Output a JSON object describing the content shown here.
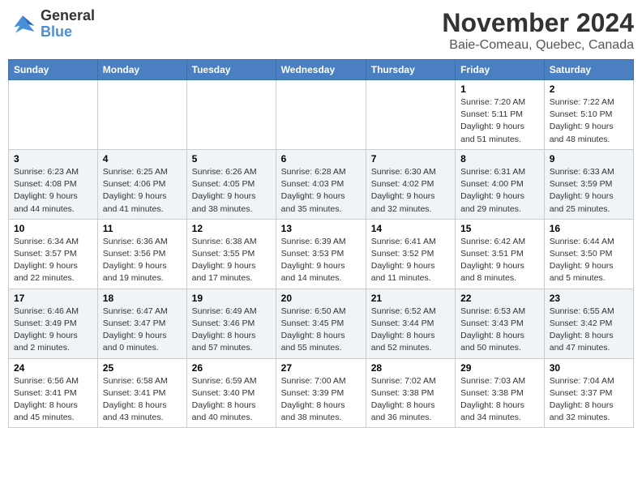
{
  "logo": {
    "line1": "General",
    "line2": "Blue"
  },
  "title": "November 2024",
  "location": "Baie-Comeau, Quebec, Canada",
  "weekdays": [
    "Sunday",
    "Monday",
    "Tuesday",
    "Wednesday",
    "Thursday",
    "Friday",
    "Saturday"
  ],
  "weeks": [
    [
      {
        "day": "",
        "info": ""
      },
      {
        "day": "",
        "info": ""
      },
      {
        "day": "",
        "info": ""
      },
      {
        "day": "",
        "info": ""
      },
      {
        "day": "",
        "info": ""
      },
      {
        "day": "1",
        "info": "Sunrise: 7:20 AM\nSunset: 5:11 PM\nDaylight: 9 hours and 51 minutes."
      },
      {
        "day": "2",
        "info": "Sunrise: 7:22 AM\nSunset: 5:10 PM\nDaylight: 9 hours and 48 minutes."
      }
    ],
    [
      {
        "day": "3",
        "info": "Sunrise: 6:23 AM\nSunset: 4:08 PM\nDaylight: 9 hours and 44 minutes."
      },
      {
        "day": "4",
        "info": "Sunrise: 6:25 AM\nSunset: 4:06 PM\nDaylight: 9 hours and 41 minutes."
      },
      {
        "day": "5",
        "info": "Sunrise: 6:26 AM\nSunset: 4:05 PM\nDaylight: 9 hours and 38 minutes."
      },
      {
        "day": "6",
        "info": "Sunrise: 6:28 AM\nSunset: 4:03 PM\nDaylight: 9 hours and 35 minutes."
      },
      {
        "day": "7",
        "info": "Sunrise: 6:30 AM\nSunset: 4:02 PM\nDaylight: 9 hours and 32 minutes."
      },
      {
        "day": "8",
        "info": "Sunrise: 6:31 AM\nSunset: 4:00 PM\nDaylight: 9 hours and 29 minutes."
      },
      {
        "day": "9",
        "info": "Sunrise: 6:33 AM\nSunset: 3:59 PM\nDaylight: 9 hours and 25 minutes."
      }
    ],
    [
      {
        "day": "10",
        "info": "Sunrise: 6:34 AM\nSunset: 3:57 PM\nDaylight: 9 hours and 22 minutes."
      },
      {
        "day": "11",
        "info": "Sunrise: 6:36 AM\nSunset: 3:56 PM\nDaylight: 9 hours and 19 minutes."
      },
      {
        "day": "12",
        "info": "Sunrise: 6:38 AM\nSunset: 3:55 PM\nDaylight: 9 hours and 17 minutes."
      },
      {
        "day": "13",
        "info": "Sunrise: 6:39 AM\nSunset: 3:53 PM\nDaylight: 9 hours and 14 minutes."
      },
      {
        "day": "14",
        "info": "Sunrise: 6:41 AM\nSunset: 3:52 PM\nDaylight: 9 hours and 11 minutes."
      },
      {
        "day": "15",
        "info": "Sunrise: 6:42 AM\nSunset: 3:51 PM\nDaylight: 9 hours and 8 minutes."
      },
      {
        "day": "16",
        "info": "Sunrise: 6:44 AM\nSunset: 3:50 PM\nDaylight: 9 hours and 5 minutes."
      }
    ],
    [
      {
        "day": "17",
        "info": "Sunrise: 6:46 AM\nSunset: 3:49 PM\nDaylight: 9 hours and 2 minutes."
      },
      {
        "day": "18",
        "info": "Sunrise: 6:47 AM\nSunset: 3:47 PM\nDaylight: 9 hours and 0 minutes."
      },
      {
        "day": "19",
        "info": "Sunrise: 6:49 AM\nSunset: 3:46 PM\nDaylight: 8 hours and 57 minutes."
      },
      {
        "day": "20",
        "info": "Sunrise: 6:50 AM\nSunset: 3:45 PM\nDaylight: 8 hours and 55 minutes."
      },
      {
        "day": "21",
        "info": "Sunrise: 6:52 AM\nSunset: 3:44 PM\nDaylight: 8 hours and 52 minutes."
      },
      {
        "day": "22",
        "info": "Sunrise: 6:53 AM\nSunset: 3:43 PM\nDaylight: 8 hours and 50 minutes."
      },
      {
        "day": "23",
        "info": "Sunrise: 6:55 AM\nSunset: 3:42 PM\nDaylight: 8 hours and 47 minutes."
      }
    ],
    [
      {
        "day": "24",
        "info": "Sunrise: 6:56 AM\nSunset: 3:41 PM\nDaylight: 8 hours and 45 minutes."
      },
      {
        "day": "25",
        "info": "Sunrise: 6:58 AM\nSunset: 3:41 PM\nDaylight: 8 hours and 43 minutes."
      },
      {
        "day": "26",
        "info": "Sunrise: 6:59 AM\nSunset: 3:40 PM\nDaylight: 8 hours and 40 minutes."
      },
      {
        "day": "27",
        "info": "Sunrise: 7:00 AM\nSunset: 3:39 PM\nDaylight: 8 hours and 38 minutes."
      },
      {
        "day": "28",
        "info": "Sunrise: 7:02 AM\nSunset: 3:38 PM\nDaylight: 8 hours and 36 minutes."
      },
      {
        "day": "29",
        "info": "Sunrise: 7:03 AM\nSunset: 3:38 PM\nDaylight: 8 hours and 34 minutes."
      },
      {
        "day": "30",
        "info": "Sunrise: 7:04 AM\nSunset: 3:37 PM\nDaylight: 8 hours and 32 minutes."
      }
    ]
  ]
}
